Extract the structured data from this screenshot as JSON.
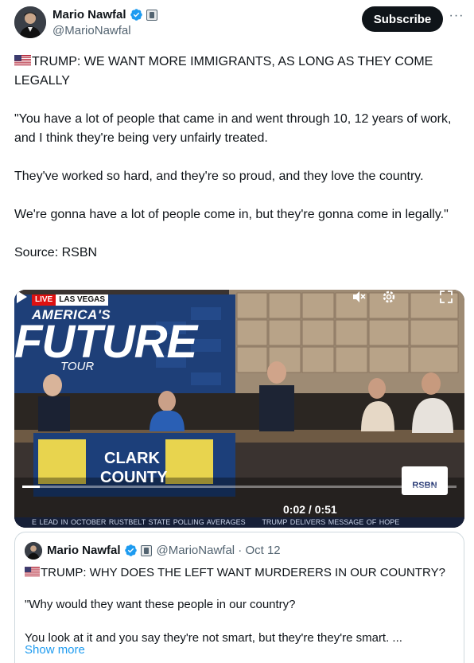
{
  "author": {
    "name": "Mario Nawfal",
    "handle": "@MarioNawfal",
    "subscribe_label": "Subscribe",
    "more_icon": "more-horizontal-icon"
  },
  "tweet": {
    "headline": "TRUMP: WE WANT MORE IMMIGRANTS, AS LONG AS THEY COME LEGALLY",
    "paragraph1": "\"You have a lot of people that came in and went through 10, 12 years of work, and I think they're being very unfairly treated.",
    "paragraph2": "They've worked so hard, and they're so proud, and they love the country.",
    "paragraph3": "We're gonna have a lot of people come in, but they're gonna come in legally.\"",
    "source": "Source: RSBN"
  },
  "video": {
    "live_label": "LIVE",
    "location_label": "LAS VEGAS",
    "title_line1": "AMERICA'S",
    "title_line2": "FUTURE",
    "title_line3": "TOUR",
    "future_label": "FUTURE",
    "sign_text": "CLARK COUNTY",
    "time_display": "0:02 / 0:51",
    "progress_fraction": 0.04,
    "ticker_left": "E LEAD IN OCTOBER RUSTBELT STATE POLLING AVERAGES",
    "ticker_right": "TRUMP DELIVERS MESSAGE OF HOPE",
    "rsbn_label": "RSBN"
  },
  "quoted": {
    "name": "Mario Nawfal",
    "handle_date": "@MarioNawfal · Oct 12",
    "headline": "TRUMP: WHY DOES THE LEFT WANT MURDERERS IN OUR COUNTRY?",
    "paragraph1": "\"Why would they want these people in our country?",
    "paragraph2": "You look at it and you say they're not smart, but they're they're smart. ...",
    "show_more": "Show more"
  },
  "colors": {
    "link": "#1d9bf0",
    "verified": "#1d9bf0",
    "text": "#0f1419",
    "secondary": "#536471"
  }
}
